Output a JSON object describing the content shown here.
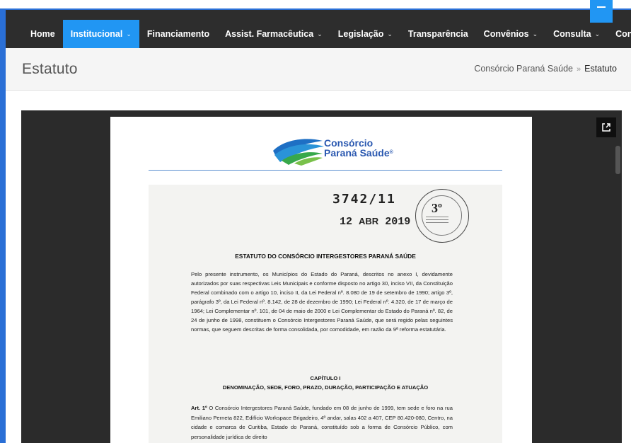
{
  "nav": {
    "items": [
      {
        "label": "Home",
        "caret": ""
      },
      {
        "label": "Institucional",
        "caret": "⌄"
      },
      {
        "label": "Financiamento",
        "caret": ""
      },
      {
        "label": "Assist. Farmacêutica",
        "caret": "⌄"
      },
      {
        "label": "Legislação",
        "caret": "⌄"
      },
      {
        "label": "Transparência",
        "caret": ""
      },
      {
        "label": "Convênios",
        "caret": "⌄"
      },
      {
        "label": "Consulta",
        "caret": "⌄"
      },
      {
        "label": "Contato",
        "caret": ""
      }
    ],
    "active_index": 1
  },
  "header": {
    "title": "Estatuto",
    "breadcrumb": {
      "home": "Consórcio Paraná Saúde",
      "separator": "»",
      "current": "Estatuto"
    }
  },
  "viewer": {
    "popout_icon": "external-link-icon"
  },
  "document": {
    "logo": {
      "line1": "Consórcio",
      "line2": "Paraná Saúde",
      "mark": "®"
    },
    "stamp_number": "3742/11",
    "stamp_day": "12",
    "stamp_month": "ABR",
    "stamp_year": "2019",
    "seal_number": "3º",
    "heading": "ESTATUTO DO CONSÓRCIO INTERGESTORES PARANÁ SAÚDE",
    "intro": "Pelo presente instrumento, os Municípios do Estado do Paraná, descritos no anexo I, devidamente autorizados por suas respectivas Leis Municipais e conforme disposto no artigo 30, inciso VII, da Constituição Federal combinado com o artigo 10, inciso II, da Lei Federal nº. 8.080 de 19 de setembro de 1990; artigo 3º, parágrafo 3º, da Lei Federal nº. 8.142, de 28 de dezembro de 1990; Lei Federal nº. 4.320, de 17 de março de 1964; Lei Complementar nº. 101, de 04 de maio de 2000 e Lei Complementar do Estado do Paraná nº. 82, de 24 de junho de 1998, constituem o Consórcio Intergestores Paraná Saúde, que será regido pelas seguintes normas, que seguem descritas de forma consolidada, por comodidade, em razão da 9ª reforma estatutária.",
    "chapter_title": "CAPÍTULO I",
    "chapter_subtitle": "DENOMINAÇÃO, SEDE, FORO, PRAZO, DURAÇÃO, PARTICIPAÇÃO E ATUAÇÃO",
    "article_label": "Art. 1º",
    "article_text": "O Consórcio Intergestores Paraná Saúde, fundado em 08 de junho de 1999, tem sede e foro na rua Emiliano Perneta 822, Edifício Workspace Brigadeiro, 4º andar, salas 402 a 407, CEP 80.420-080, Centro, na cidade e comarca de Curitiba, Estado do Paraná, constituído sob a forma de Consórcio Público, com personalidade jurídica de direito"
  }
}
